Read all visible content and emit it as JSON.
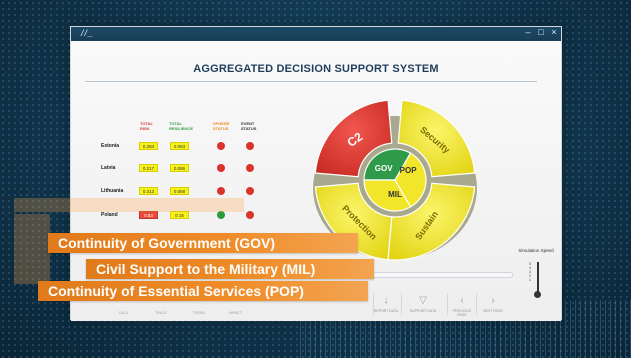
{
  "window": {
    "logo": "//_",
    "controls": [
      "‒",
      "□",
      "×"
    ]
  },
  "app_title": "AGGREGATED DECISION SUPPORT SYSTEM",
  "table": {
    "headers": [
      {
        "text": "TOTAL RISK",
        "color": "#e0303a"
      },
      {
        "text": "TOTAL RESILIENCE",
        "color": "#2ea043"
      },
      {
        "text": "SPHERE STATUS",
        "color": "#f08a1c"
      },
      {
        "text": "EVENT STATUS",
        "color": "#333333"
      }
    ],
    "rows": [
      {
        "country": "Estonia",
        "risk": "0.284",
        "risk_level": "y",
        "resilience": "0.083",
        "sphere": "r",
        "event": "r"
      },
      {
        "country": "Latvia",
        "risk": "0.217",
        "risk_level": "y",
        "resilience": "0.086",
        "sphere": "r",
        "event": "r"
      },
      {
        "country": "Lithuania",
        "risk": "0.313",
        "risk_level": "y",
        "resilience": "0.068",
        "sphere": "r",
        "event": "r"
      },
      {
        "country": "Poland",
        "risk": "0.83",
        "risk_level": "r",
        "resilience": "0.15",
        "sphere": "g",
        "event": "r"
      }
    ]
  },
  "wheel": {
    "outer": [
      {
        "label": "C2",
        "color": "#e03a33"
      },
      {
        "label": "Security",
        "color": "#f2e62a"
      },
      {
        "label": "Sustain",
        "color": "#f2e62a"
      },
      {
        "label": "Protection",
        "color": "#f2e62a"
      }
    ],
    "inner": [
      {
        "label": "GOV",
        "color": "#2f9a4a"
      },
      {
        "label": "POP",
        "color": "#f2e62a"
      },
      {
        "label": "MIL",
        "color": "#f2e62a"
      }
    ]
  },
  "simulation": {
    "label": "Simulation Speed",
    "scale": [
      "5",
      "4",
      "3",
      "2",
      "1"
    ]
  },
  "toolbar": {
    "buttons": [
      {
        "icon": "↓",
        "label": "REPORT DATA"
      },
      {
        "icon": "▽",
        "label": "SUPPORT DATA"
      },
      {
        "icon": "‹",
        "label": "PREVIOUS PAGE"
      },
      {
        "icon": "›",
        "label": "NEXT PAGE"
      }
    ],
    "small_left": [
      "DATA",
      "TRACE",
      "TREND",
      "IMPACT"
    ]
  },
  "banners": [
    "Continuity of Government (GOV)",
    "Civil Support to the Military (MIL)",
    "Continuity of Essential Services (POP)"
  ]
}
